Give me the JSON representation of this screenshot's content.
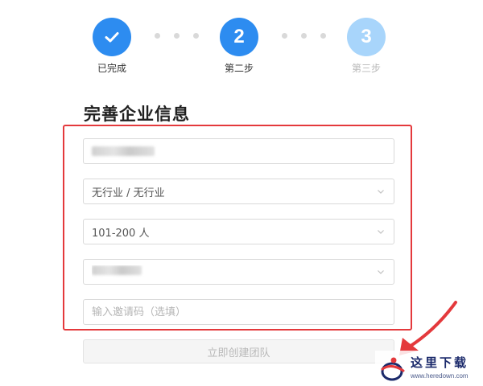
{
  "stepper": {
    "steps": [
      {
        "state": "done",
        "number": "",
        "label": "已完成"
      },
      {
        "state": "active",
        "number": "2",
        "label": "第二步"
      },
      {
        "state": "pending",
        "number": "3",
        "label": "第三步"
      }
    ]
  },
  "form": {
    "title": "完善企业信息",
    "industry_value": "无行业 / 无行业",
    "size_value": "101-200 人",
    "invite_placeholder": "输入邀请码（选填）",
    "submit_label": "立即创建团队"
  },
  "colors": {
    "primary": "#2d8cf0",
    "pending": "#a8d5fb",
    "highlight": "#e4393c",
    "arrow": "#e4393c"
  },
  "watermark": {
    "title": "这里下载",
    "url": "www.heredown.com"
  }
}
